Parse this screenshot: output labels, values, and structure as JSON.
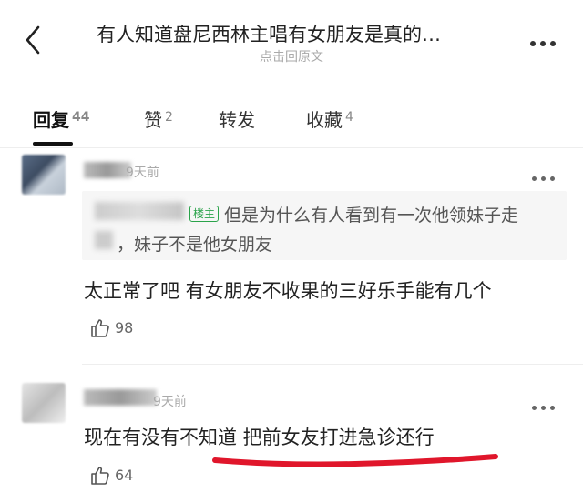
{
  "header": {
    "title": "有人知道盘尼西林主唱有女朋友是真的…",
    "subtitle": "点击回原文"
  },
  "tabs": [
    {
      "label": "回复",
      "count": "44"
    },
    {
      "label": "赞",
      "count": "2"
    },
    {
      "label": "转发",
      "count": ""
    },
    {
      "label": "收藏",
      "count": "4"
    }
  ],
  "comments": [
    {
      "time": "9天前",
      "quote": {
        "badge": "楼主",
        "line1": "但是为什么有人看到有一次他领妹子走",
        "line2": "，妹子不是他女朋友"
      },
      "text": "太正常了吧 有女朋友不收果的三好乐手能有几个",
      "likes": "98"
    },
    {
      "time": "9天前",
      "text": "现在有没有不知道 把前女友打进急诊还行",
      "likes": "64"
    }
  ],
  "colors": {
    "underline_red": "#e0162b",
    "badge_green": "#2aa34a"
  }
}
